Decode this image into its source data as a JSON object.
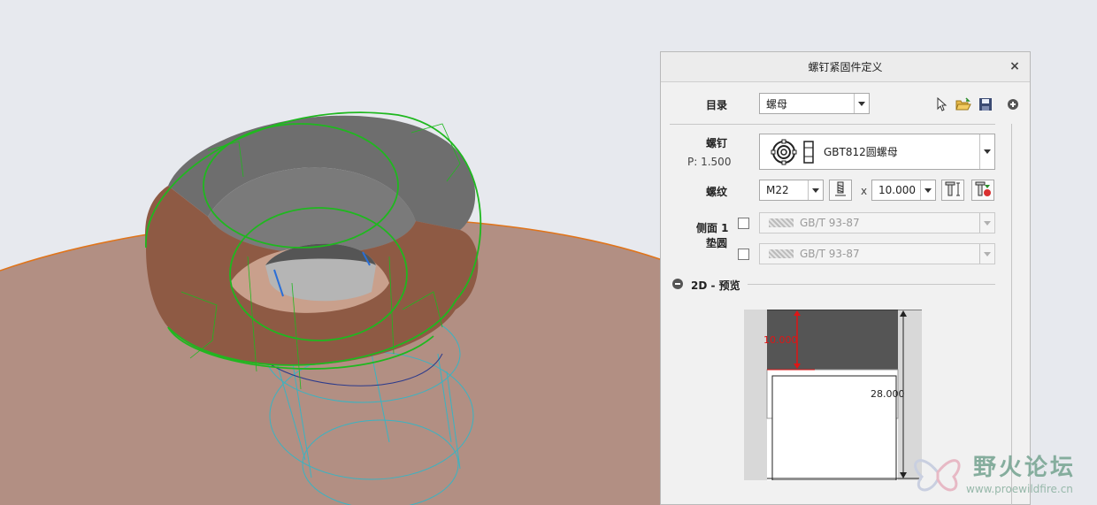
{
  "dialog": {
    "title": "螺钉紧固件定义",
    "close_symbol": "×",
    "catalog": {
      "label": "目录",
      "value": "螺母"
    },
    "screw": {
      "label": "螺钉",
      "pitch": "P: 1.500",
      "value": "GBT812圆螺母"
    },
    "thread": {
      "label": "螺纹",
      "size": "M22",
      "times": "x",
      "length": "10.000"
    },
    "side": {
      "label": "侧面 1",
      "washer_label": "垫圆",
      "washer1": "GB/T 93-87",
      "washer2": "GB/T 93-87"
    },
    "preview": {
      "section_label": "2D - 预览",
      "dim_nut": "10.000",
      "dim_bolt": "28.000",
      "colors": {
        "nut_fill": "#555555",
        "dimension_red": "#e01515"
      }
    }
  },
  "watermark": {
    "text": "野火论坛",
    "url": "www.proewildfire.cn"
  },
  "colors": {
    "surface": "#b28f83",
    "wire_green": "#1fb81f",
    "wire_cyan": "#3ab3c2",
    "edge_orange": "#e0741a"
  }
}
